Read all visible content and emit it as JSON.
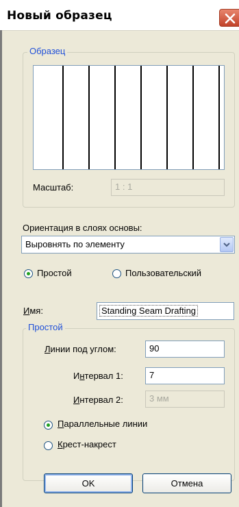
{
  "window": {
    "title": "Новый образец"
  },
  "sample_group": {
    "label": "Образец",
    "scale_label": "Масштаб:",
    "scale_value": "1 : 1"
  },
  "orientation": {
    "label": "Ориентация в слоях основы:",
    "selected": "Выровнять по элементу"
  },
  "type_options": [
    {
      "label": "Простой",
      "checked": true
    },
    {
      "label": "Пользовательский",
      "checked": false
    }
  ],
  "name": {
    "label": "Имя:",
    "value": "Standing Seam Drafting"
  },
  "simple_group": {
    "label": "Простой",
    "angle_label": "Линии под углом:",
    "angle_value": "90",
    "interval1_label": "Интервал 1:",
    "interval1_value": "7",
    "interval2_label": "Интервал 2:",
    "interval2_value": "3 мм",
    "options": [
      {
        "label": "Параллельные линии",
        "checked": true
      },
      {
        "label": "Крест-накрест",
        "checked": false
      }
    ]
  },
  "buttons": {
    "ok": "OK",
    "cancel": "Отмена"
  }
}
